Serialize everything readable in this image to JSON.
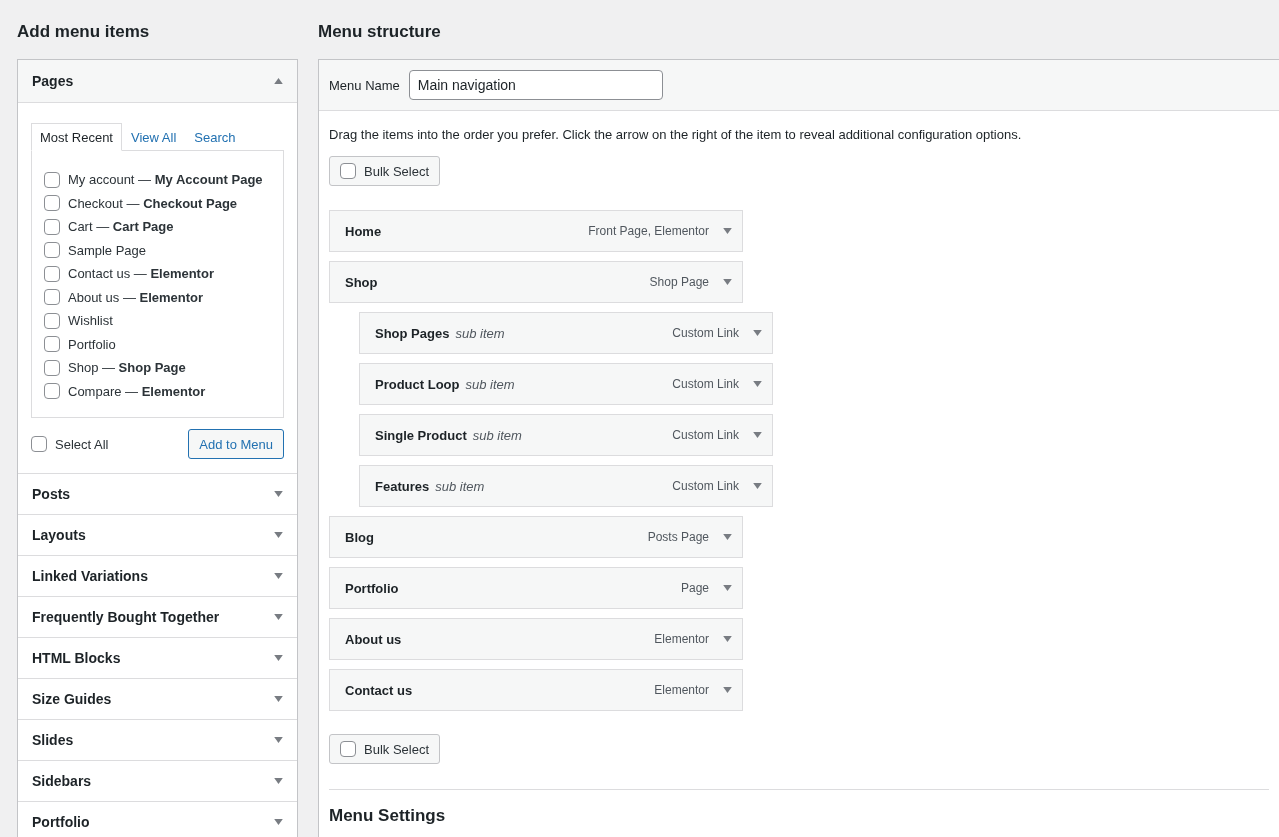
{
  "left": {
    "heading": "Add menu items",
    "pages_panel": {
      "title": "Pages",
      "expanded": true,
      "tabs": [
        {
          "label": "Most Recent",
          "selected": true
        },
        {
          "label": "View All",
          "selected": false
        },
        {
          "label": "Search",
          "selected": false
        }
      ],
      "items": [
        {
          "label": "My account — **My Account Page**",
          "checked": false
        },
        {
          "label": "Checkout — **Checkout Page**",
          "checked": false
        },
        {
          "label": "Cart — **Cart Page**",
          "checked": false
        },
        {
          "label": "Sample Page",
          "checked": false
        },
        {
          "label": "Contact us — **Elementor**",
          "checked": false
        },
        {
          "label": "About us — **Elementor**",
          "checked": false
        },
        {
          "label": "Wishlist",
          "checked": false
        },
        {
          "label": "Portfolio",
          "checked": false
        },
        {
          "label": "Shop — **Shop Page**",
          "checked": false
        },
        {
          "label": "Compare — **Elementor**",
          "checked": false
        }
      ],
      "select_all": {
        "label": "Select All",
        "checked": false
      },
      "add_button": "Add to Menu"
    },
    "sections": [
      {
        "title": "Posts",
        "expanded": false
      },
      {
        "title": "Layouts",
        "expanded": false
      },
      {
        "title": "Linked Variations",
        "expanded": false
      },
      {
        "title": "Frequently Bought Together",
        "expanded": false
      },
      {
        "title": "HTML Blocks",
        "expanded": false
      },
      {
        "title": "Size Guides",
        "expanded": false
      },
      {
        "title": "Slides",
        "expanded": false
      },
      {
        "title": "Sidebars",
        "expanded": false
      },
      {
        "title": "Portfolio",
        "expanded": false
      }
    ]
  },
  "right": {
    "heading": "Menu structure",
    "menu_name_label": "Menu Name",
    "menu_name_value": "Main navigation",
    "instructions": "Drag the items into the order you prefer. Click the arrow on the right of the item to reveal additional configuration options.",
    "bulk_select_top": {
      "label": "Bulk Select",
      "checked": false
    },
    "menu_items": [
      {
        "label": "Home",
        "type": "Front Page, Elementor"
      },
      {
        "label": "Shop",
        "type": "Shop Page",
        "children": [
          {
            "label": "Shop Pages",
            "note": "sub item",
            "type": "Custom Link"
          },
          {
            "label": "Product Loop",
            "note": "sub item",
            "type": "Custom Link"
          },
          {
            "label": "Single Product",
            "note": "sub item",
            "type": "Custom Link"
          },
          {
            "label": "Features",
            "note": "sub item",
            "type": "Custom Link"
          }
        ]
      },
      {
        "label": "Blog",
        "type": "Posts Page"
      },
      {
        "label": "Portfolio",
        "type": "Page"
      },
      {
        "label": "About us",
        "type": "Elementor"
      },
      {
        "label": "Contact us",
        "type": "Elementor"
      }
    ],
    "bulk_select_bottom": {
      "label": "Bulk Select",
      "checked": false
    },
    "settings_heading": "Menu Settings"
  }
}
